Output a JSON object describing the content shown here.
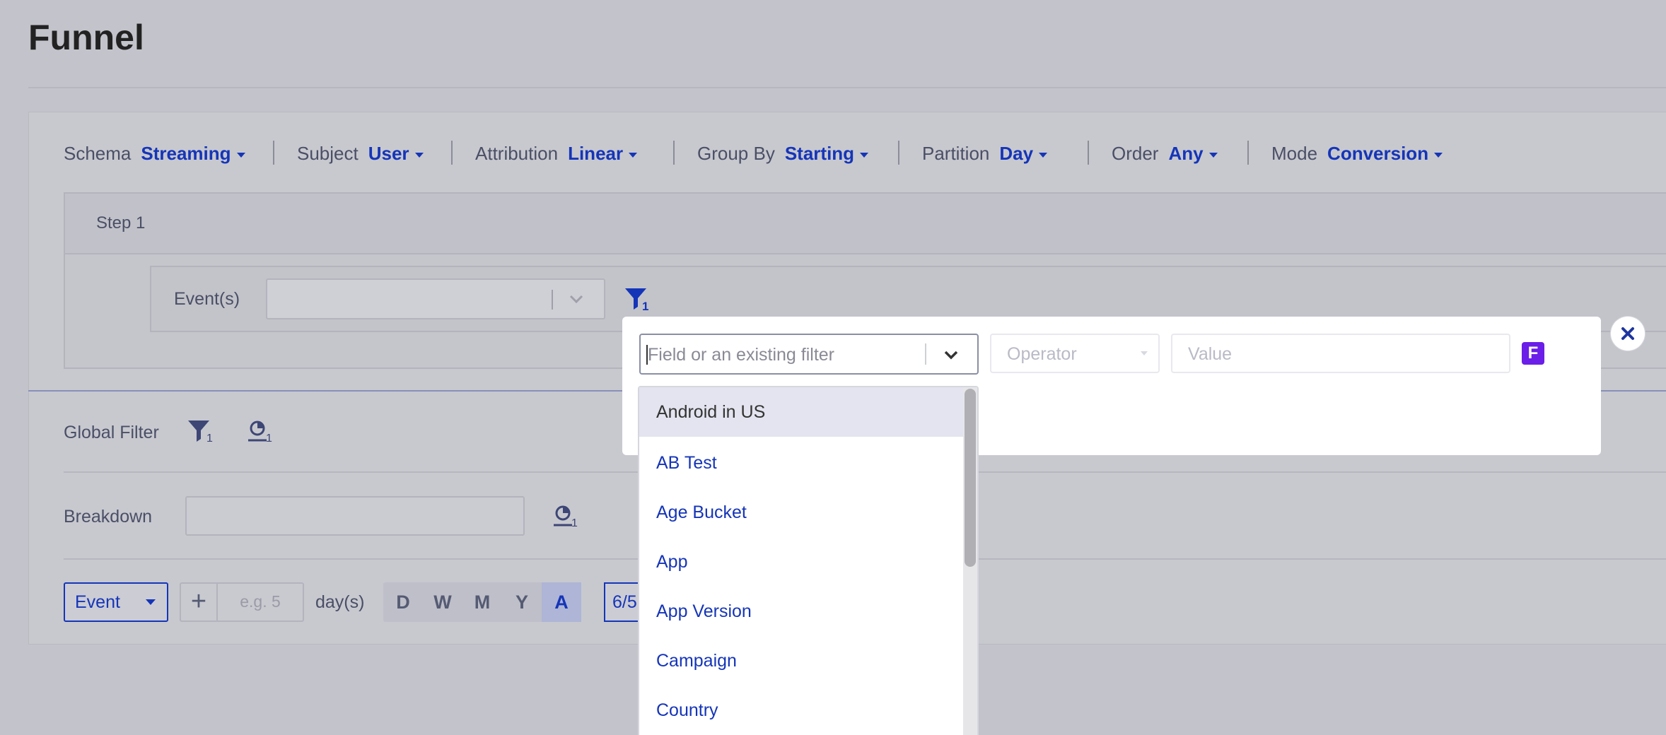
{
  "page": {
    "title": "Funnel"
  },
  "settings": [
    {
      "label": "Schema",
      "value": "Streaming"
    },
    {
      "label": "Subject",
      "value": "User"
    },
    {
      "label": "Attribution",
      "value": "Linear"
    },
    {
      "label": "Group By",
      "value": "Starting"
    },
    {
      "label": "Partition",
      "value": "Day"
    },
    {
      "label": "Order",
      "value": "Any"
    },
    {
      "label": "Mode",
      "value": "Conversion"
    }
  ],
  "step": {
    "label": "Step 1",
    "events_label": "Event(s)",
    "events_value": "",
    "filter_count": "1"
  },
  "global_filter": {
    "label": "Global Filter",
    "filter_count": "1",
    "segment_count": "1"
  },
  "breakdown": {
    "label": "Breakdown",
    "value": "",
    "segment_count": "1"
  },
  "bottom": {
    "event_dropdown": "Event",
    "plus": "+",
    "days_placeholder": "e.g. 5",
    "days_label": "day(s)",
    "periods": [
      "D",
      "W",
      "M",
      "Y",
      "A"
    ],
    "active_period": "A",
    "date_partial": "6/5"
  },
  "filter_popup": {
    "field_placeholder": "Field or an existing filter",
    "operator_placeholder": "Operator",
    "value_placeholder": "Value",
    "formula_button": "F",
    "close": "✕",
    "options": [
      "Android in US",
      "AB Test",
      "Age Bucket",
      "App",
      "App Version",
      "Campaign",
      "Country"
    ],
    "highlighted_option": "Android in US"
  },
  "colors": {
    "accent": "#1535b8",
    "formula": "#6a1ee8",
    "overlay": "#c3c4cb"
  }
}
